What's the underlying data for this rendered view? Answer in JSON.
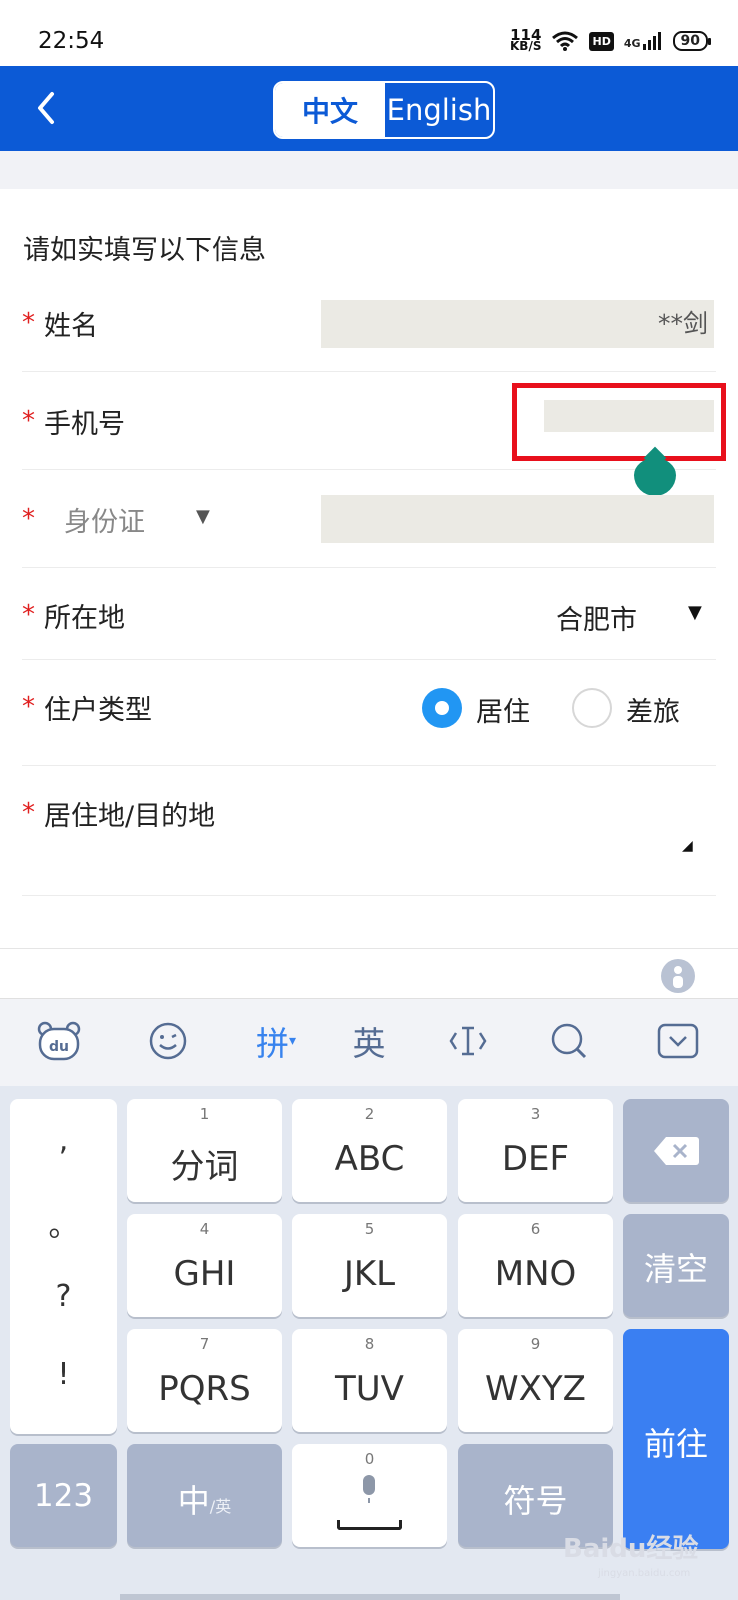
{
  "status_bar": {
    "time": "22:54",
    "net_speed_value": "114",
    "net_speed_unit": "KB/S",
    "hd_label": "HD",
    "network_label": "4G",
    "battery": "90"
  },
  "header": {
    "lang_cn": "中文",
    "lang_en": "English",
    "back_icon": "chevron-left-icon",
    "bg_color": "#0c5ad6"
  },
  "form": {
    "intro": "请如实填写以下信息",
    "required_mark": "*",
    "name_label": "姓名",
    "name_value": "**剑",
    "phone_label": "手机号",
    "id_type_label": "身份证",
    "location_label": "所在地",
    "location_value": "合肥市",
    "dropdown_arrow": "▼",
    "resident_type_label": "住户类型",
    "resident_option_1": "居住",
    "resident_option_2": "差旅",
    "destination_label": "居住地/目的地"
  },
  "keyboard": {
    "toolbar": {
      "pinyin": "拼",
      "english": "英"
    },
    "punct": [
      ",",
      "。",
      "?",
      "!"
    ],
    "keys": [
      {
        "num": "1",
        "label": "分词"
      },
      {
        "num": "2",
        "label": "ABC"
      },
      {
        "num": "3",
        "label": "DEF"
      },
      {
        "num": "4",
        "label": "GHI"
      },
      {
        "num": "5",
        "label": "JKL"
      },
      {
        "num": "6",
        "label": "MNO"
      },
      {
        "num": "7",
        "label": "PQRS"
      },
      {
        "num": "8",
        "label": "TUV"
      },
      {
        "num": "9",
        "label": "WXYZ"
      }
    ],
    "clear": "清空",
    "go": "前往",
    "num_key": "123",
    "zh_key": "中",
    "zh_key_sub": "/英",
    "space_num": "0",
    "symbol_key": "符号"
  },
  "watermark": {
    "text": "Baidu经验",
    "sub": "jingyan.baidu.com"
  }
}
